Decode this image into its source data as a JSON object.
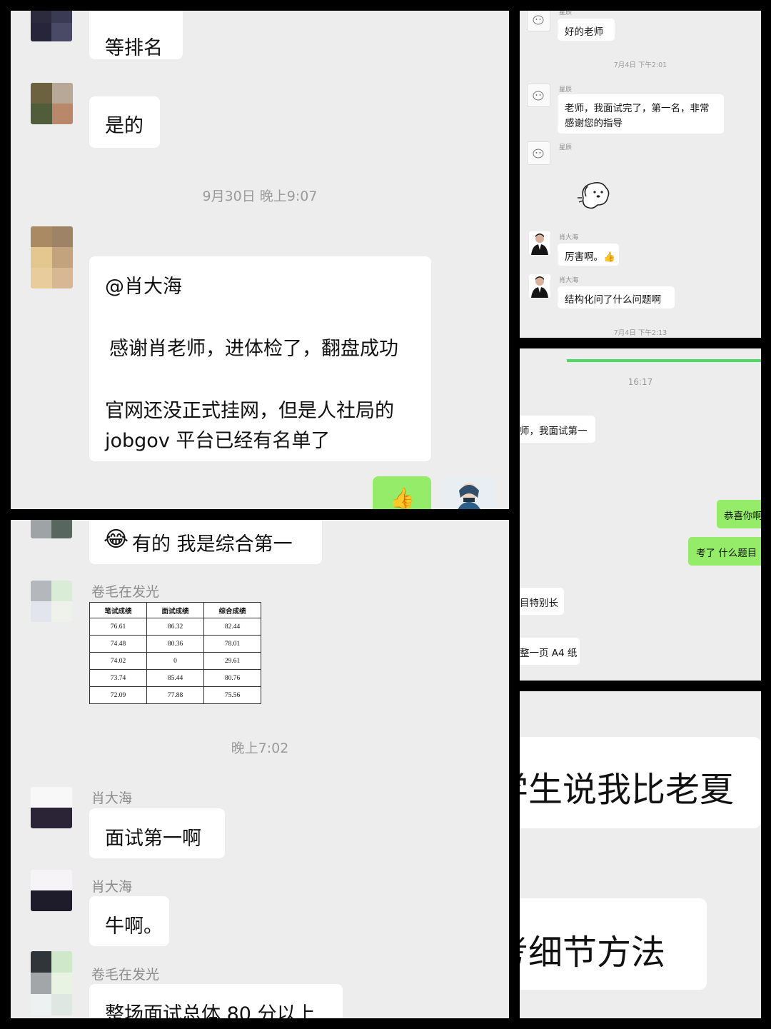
{
  "panel_a": {
    "msg_top": "等排名",
    "msg_shi": "是的",
    "timestamp": "9月30日 晚上9:07",
    "big_msg": {
      "line1": "@肖大海",
      "line2": "感谢肖老师，进体检了，翻盘成功",
      "line3": "官网还没正式挂网，但是人社局的",
      "line4": "jobgov 平台已经有名单了"
    },
    "reply_emoji": "👍"
  },
  "panel_b": {
    "sender_top": "星辰",
    "msg1": "好的老师",
    "timestamp1": "7月4日 下午2:01",
    "sender1": "星辰",
    "msg2_line1": "老师，我面试完了，第一名，非常",
    "msg2_line2": "感谢您的指导",
    "sender2": "星辰",
    "sender3": "肖大海",
    "msg3": "厉害啊。👍",
    "sender4": "肖大海",
    "msg4": "结构化问了什么问题啊",
    "timestamp2": "7月4日 下午2:13"
  },
  "panel_c": {
    "timestamp": "16:17",
    "msg1": "师，我面试第一",
    "msg2": "恭喜你啊",
    "msg3": "考了 什么题目",
    "msg4": "目特别长",
    "msg5": "整一页 A4 纸"
  },
  "panel_d": {
    "msg1": "有的 我是综合第一",
    "msg1_emoji": "😂",
    "sender1": "卷毛在发光",
    "table": {
      "headers": [
        "笔试成绩",
        "面试成绩",
        "综合成绩"
      ],
      "rows": [
        [
          "76.61",
          "86.32",
          "82.44"
        ],
        [
          "74.48",
          "80.36",
          "78.01"
        ],
        [
          "74.02",
          "0",
          "29.61"
        ],
        [
          "73.74",
          "85.44",
          "80.76"
        ],
        [
          "72.09",
          "77.88",
          "75.56"
        ]
      ]
    },
    "timestamp": "晚上7:02",
    "sender2": "肖大海",
    "msg2": "面试第一啊",
    "sender3": "肖大海",
    "msg3": "牛啊。",
    "sender4": "卷毛在发光",
    "msg4": "整场面试总体 80 分以上"
  },
  "panel_e": {
    "msg1": "学生说我比老夏",
    "msg2": "考细节方法"
  },
  "colors": {
    "chat_bg": "#ededed",
    "bubble_white": "#ffffff",
    "bubble_green": "#95ec69",
    "timestamp_gray": "#9a9a9a",
    "frame_black": "#000000"
  },
  "icons": {
    "thumbs_up": "thumbs-up-icon",
    "laughing_face": "laughing-face-icon",
    "puppy_sticker": "puppy-sticker-icon"
  }
}
